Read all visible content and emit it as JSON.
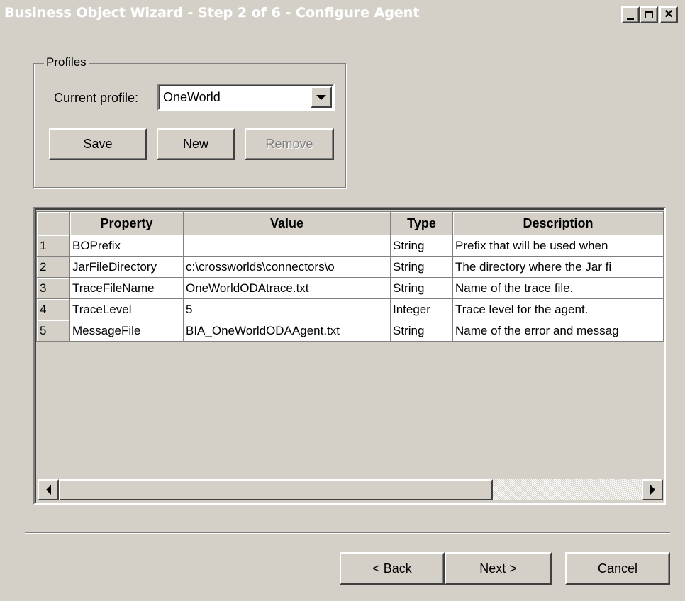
{
  "window": {
    "title": "Business Object Wizard - Step 2 of 6 - Configure Agent",
    "minimize_label": "_",
    "close_label": "✕"
  },
  "profiles": {
    "group_label": "Profiles",
    "current_profile_label": "Current profile:",
    "current_profile_value": "OneWorld",
    "save_label": "Save",
    "new_label": "New",
    "remove_label": "Remove"
  },
  "grid": {
    "columns": [
      "",
      "Property",
      "Value",
      "Type",
      "Description"
    ],
    "rows": [
      {
        "num": "1",
        "property": "BOPrefix",
        "value": "",
        "type": "String",
        "description": "Prefix that will be used when"
      },
      {
        "num": "2",
        "property": "JarFileDirectory",
        "value": "c:\\crossworlds\\connectors\\o",
        "type": "String",
        "description": "The directory where the Jar fi"
      },
      {
        "num": "3",
        "property": "TraceFileName",
        "value": "OneWorldODAtrace.txt",
        "type": "String",
        "description": "Name of the trace file."
      },
      {
        "num": "4",
        "property": "TraceLevel",
        "value": "5",
        "type": "Integer",
        "description": "Trace level for the agent."
      },
      {
        "num": "5",
        "property": "MessageFile",
        "value": "BIA_OneWorldODAAgent.txt",
        "type": "String",
        "description": "Name of the error and messag"
      }
    ]
  },
  "footer": {
    "back_label": "< Back",
    "next_label": "Next >",
    "cancel_label": "Cancel"
  }
}
